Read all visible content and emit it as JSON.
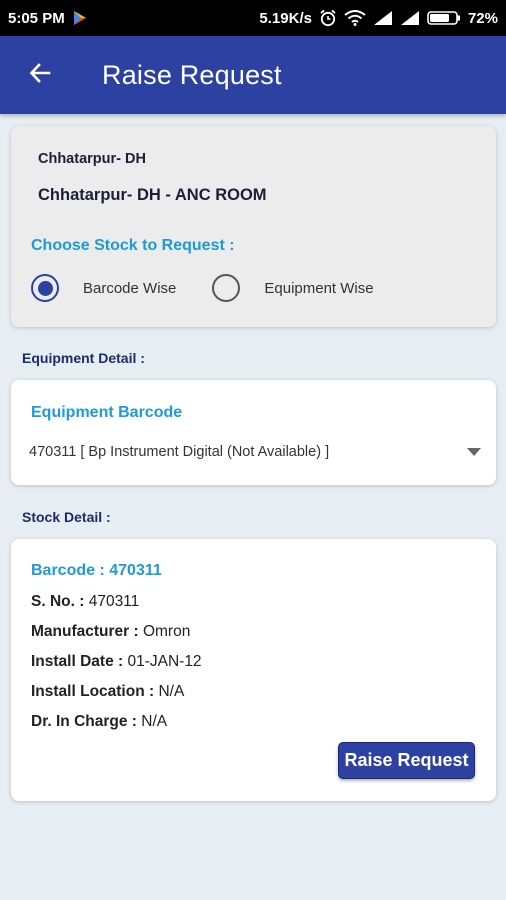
{
  "status_bar": {
    "time": "5:05 PM",
    "speed": "5.19K/s",
    "battery": "72%",
    "icons": [
      "play-store-icon",
      "alarm-icon",
      "wifi-icon",
      "signal-icon",
      "signal-icon",
      "battery-icon"
    ]
  },
  "app_bar": {
    "title": "Raise Request",
    "back_icon": "arrow-back-icon"
  },
  "location": {
    "facility": "Chhatarpur- DH",
    "room": "Chhatarpur- DH - ANC ROOM"
  },
  "stock_choice": {
    "label": "Choose Stock to Request :",
    "options": [
      {
        "label": "Barcode Wise",
        "selected": true
      },
      {
        "label": "Equipment Wise",
        "selected": false
      }
    ]
  },
  "equipment_detail": {
    "section_label": "Equipment Detail :",
    "field_label": "Equipment Barcode",
    "selected_value": "470311 [ Bp Instrument Digital (Not Available) ]"
  },
  "stock_detail": {
    "section_label": "Stock Detail :",
    "barcode": "Barcode : 470311",
    "rows": [
      {
        "key": "S. No. :",
        "value": "470311"
      },
      {
        "key": "Manufacturer :",
        "value": "Omron"
      },
      {
        "key": "Install Date :",
        "value": "01-JAN-12"
      },
      {
        "key": "Install Location :",
        "value": "N/A"
      },
      {
        "key": "Dr. In Charge :",
        "value": "N/A"
      }
    ],
    "button_label": "Raise Request"
  },
  "colors": {
    "primary": "#2d41a3",
    "accent": "#1d9bd6",
    "background": "#e6eef3"
  }
}
